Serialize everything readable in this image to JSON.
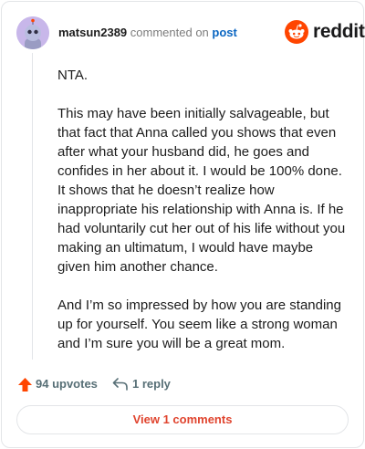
{
  "header": {
    "username": "matsun2389",
    "action_text": "commented on",
    "post_link": "post",
    "brand": "reddit"
  },
  "comment": {
    "paragraphs": [
      "NTA.",
      "This may have been initially salvageable, but that fact that Anna called you shows that even after what your husband did, he goes and confides in her about it. I would be 100% done. It shows that he doesn’t realize how inappropriate his relationship with Anna is. If he had voluntarily cut her out of his life without you making an ultimatum, I would have maybe given him another chance.",
      "And I’m so impressed by how you are standing up for yourself. You seem like a strong woman and I’m sure you will be a great mom."
    ]
  },
  "actions": {
    "upvotes": "94 upvotes",
    "reply": "1 reply",
    "view_comments": "View 1 comments"
  },
  "colors": {
    "brand": "#ff4500",
    "link": "#0a66c2",
    "view_comments": "#e0442e",
    "avatar_bg": "#c8b7ea",
    "muted": "#576f76"
  },
  "icons": {
    "avatar": "snoo-avatar",
    "brand": "reddit-logo-icon",
    "upvote": "upvote-arrow-icon",
    "reply": "reply-arrow-icon"
  }
}
